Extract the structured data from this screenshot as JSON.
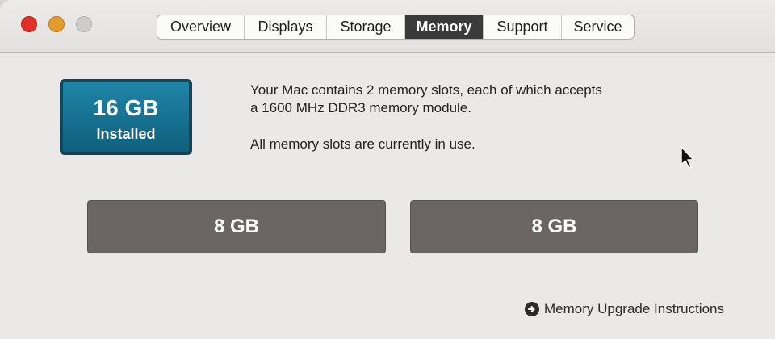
{
  "window": {
    "controls": [
      {
        "name": "close",
        "color": "#e0302a"
      },
      {
        "name": "minimize",
        "color": "#e39b2c"
      },
      {
        "name": "zoom",
        "color": "#cfcdcc"
      }
    ]
  },
  "tabs": [
    {
      "label": "Overview",
      "active": false
    },
    {
      "label": "Displays",
      "active": false
    },
    {
      "label": "Storage",
      "active": false
    },
    {
      "label": "Memory",
      "active": true
    },
    {
      "label": "Support",
      "active": false
    },
    {
      "label": "Service",
      "active": false
    }
  ],
  "memory": {
    "installed_amount": "16 GB",
    "installed_label": "Installed",
    "description_line1": "Your Mac contains 2 memory slots, each of which accepts",
    "description_line2": "a 1600 MHz DDR3 memory module.",
    "status": "All memory slots are currently in use.",
    "slots": [
      "8 GB",
      "8 GB"
    ],
    "upgrade_link": "Memory Upgrade Instructions"
  },
  "colors": {
    "installed_badge": "#1a7a9c",
    "slot_fill": "#6b6665",
    "active_tab": "#3a3a3a"
  },
  "icons": {
    "upgrade_link": "circled-arrow-right-icon",
    "cursor": "mouse-pointer-icon"
  }
}
